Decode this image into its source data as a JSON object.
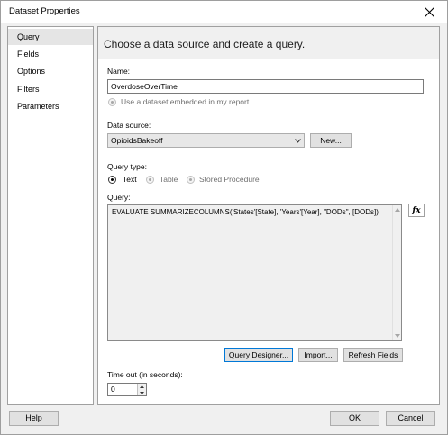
{
  "window": {
    "title": "Dataset Properties"
  },
  "nav": {
    "items": [
      {
        "label": "Query",
        "selected": true
      },
      {
        "label": "Fields",
        "selected": false
      },
      {
        "label": "Options",
        "selected": false
      },
      {
        "label": "Filters",
        "selected": false
      },
      {
        "label": "Parameters",
        "selected": false
      }
    ]
  },
  "content": {
    "header": "Choose a data source and create a query.",
    "name_label": "Name:",
    "name_value": "OverdoseOverTime",
    "embedded_option": "Use a dataset embedded in my report.",
    "datasource_label": "Data source:",
    "datasource_value": "OpioidsBakeoff",
    "new_button": "New...",
    "query_type_label": "Query type:",
    "query_types": [
      {
        "label": "Text",
        "selected": true,
        "enabled": true
      },
      {
        "label": "Table",
        "selected": false,
        "enabled": false
      },
      {
        "label": "Stored Procedure",
        "selected": false,
        "enabled": false
      }
    ],
    "query_label": "Query:",
    "query_text": "EVALUATE SUMMARIZECOLUMNS('States'[State], 'Years'[Year], \"DODs\", [DODs])",
    "fx_label": "fx",
    "query_designer_button": "Query Designer...",
    "import_button": "Import...",
    "refresh_fields_button": "Refresh Fields",
    "timeout_label": "Time out (in seconds):",
    "timeout_value": "0"
  },
  "footer": {
    "help_button": "Help",
    "ok_button": "OK",
    "cancel_button": "Cancel"
  },
  "colors": {
    "window_bg": "#f0f0f0",
    "selected_nav": "#e5e5e5",
    "default_button_border": "#0078d7"
  }
}
